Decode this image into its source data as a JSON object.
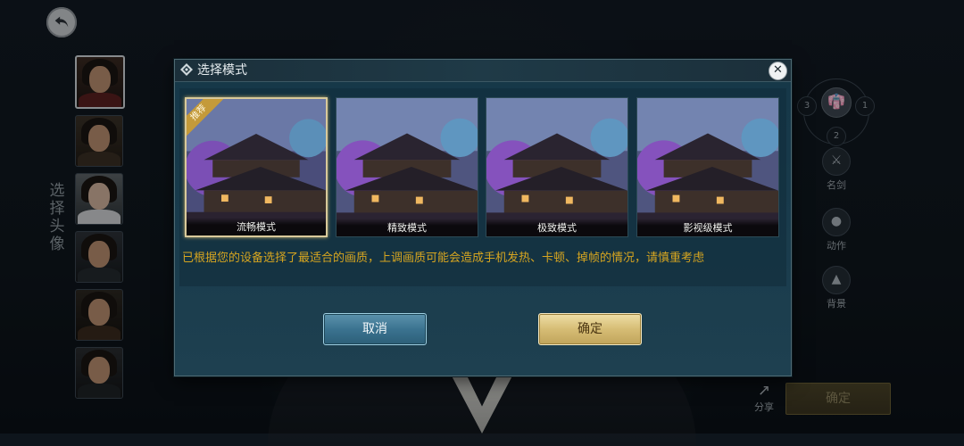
{
  "background": {
    "avatar_title": "选择头像",
    "avatars": [
      "avatar-1",
      "avatar-2",
      "avatar-3",
      "avatar-4",
      "avatar-5",
      "avatar-6"
    ],
    "right_panel": {
      "ring_numbers": [
        "3",
        "1",
        "2"
      ],
      "outfit_icon": "robe-icon",
      "buttons": [
        {
          "label": "名剑",
          "icon": "sword-icon"
        },
        {
          "label": "动作",
          "icon": "person-icon"
        },
        {
          "label": "背景",
          "icon": "mountain-icon"
        }
      ],
      "share_label": "分享",
      "share_icon": "share-arrow-icon",
      "confirm_label": "确定"
    }
  },
  "dialog": {
    "title": "选择模式",
    "title_icon": "diamond-ornament-icon",
    "close_icon": "close-icon",
    "recommended_tag": "推荐",
    "modes": [
      {
        "label": "流畅模式",
        "selected": true
      },
      {
        "label": "精致模式",
        "selected": false
      },
      {
        "label": "极致模式",
        "selected": false
      },
      {
        "label": "影视级模式",
        "selected": false
      }
    ],
    "hint": "已根据您的设备选择了最适合的画质，上调画质可能会造成手机发热、卡顿、掉帧的情况，请慎重考虑",
    "cancel_label": "取消",
    "ok_label": "确定"
  },
  "colors": {
    "hint_text": "#d6a520",
    "selected_border": "#d8c99a",
    "cancel_button": "#3b7390",
    "ok_button": "#d6bd75"
  }
}
